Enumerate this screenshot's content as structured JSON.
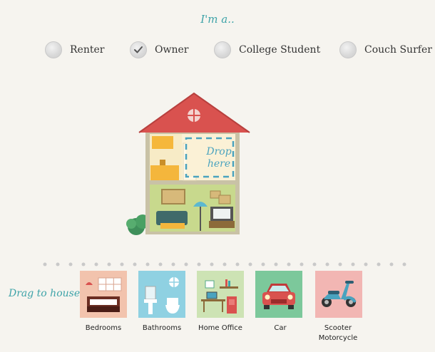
{
  "header": {
    "title": "I'm a.."
  },
  "roles": [
    {
      "label": "Renter",
      "selected": false
    },
    {
      "label": "Owner",
      "selected": true
    },
    {
      "label": "College Student",
      "selected": false
    },
    {
      "label": "Couch Surfer",
      "selected": false
    }
  ],
  "house": {
    "drop_zone_label": "Drop here"
  },
  "drag": {
    "label": "Drag to house",
    "items": [
      {
        "label": "Bedrooms",
        "icon": "bedroom-icon",
        "color": "#f2c3ad"
      },
      {
        "label": "Bathrooms",
        "icon": "bathroom-icon",
        "color": "#8fd1e2"
      },
      {
        "label": "Home Office",
        "icon": "home-office-icon",
        "color": "#cde3b4"
      },
      {
        "label": "Car",
        "icon": "car-icon",
        "color": "#7cc89b"
      },
      {
        "label": "Scooter Motorcycle",
        "icon": "scooter-icon",
        "color": "#f2b6b3"
      }
    ]
  },
  "colors": {
    "accent": "#3ea3a8",
    "roof": "#d9524f",
    "background": "#f6f4ef"
  }
}
